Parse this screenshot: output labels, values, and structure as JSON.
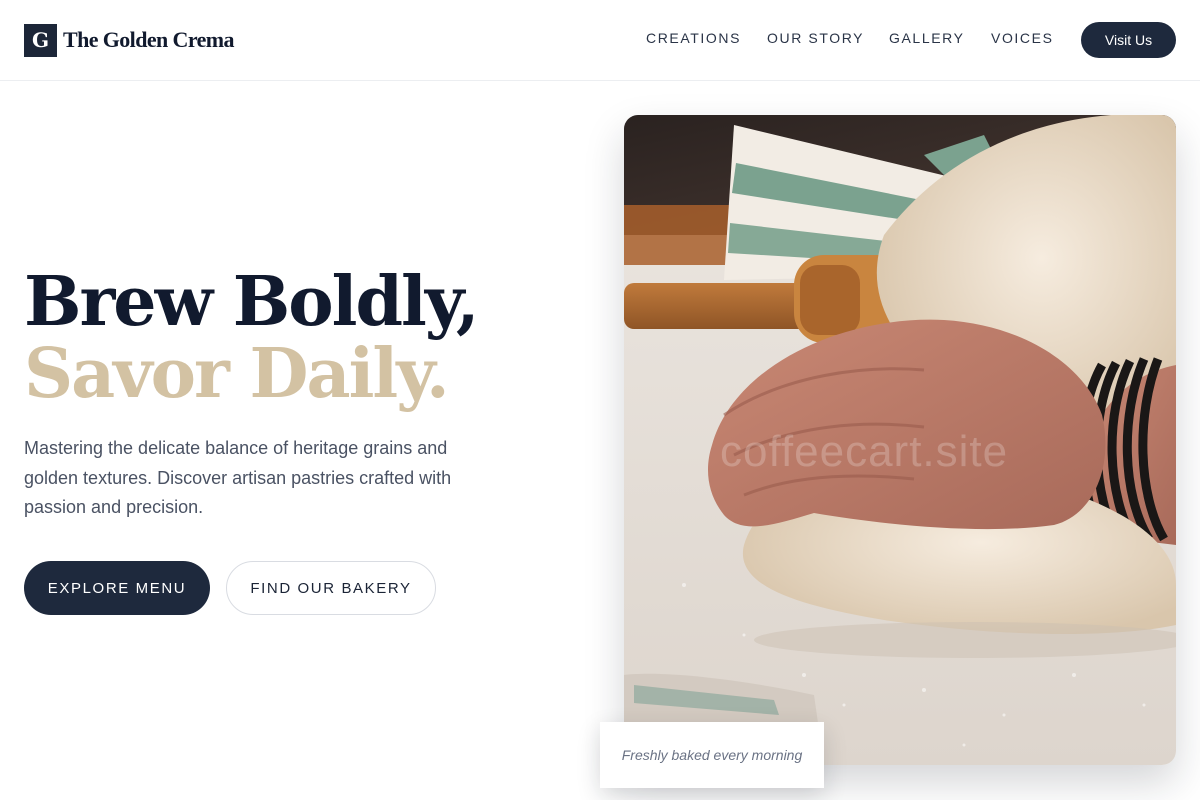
{
  "brand": {
    "logo_letter": "G",
    "name": "The Golden Crema"
  },
  "nav": {
    "items": [
      "CREATIONS",
      "OUR STORY",
      "GALLERY",
      "VOICES"
    ],
    "cta_label": "Visit Us"
  },
  "hero": {
    "headline_line1": "Brew Boldly,",
    "headline_line2": "Savor Daily.",
    "description": "Mastering the delicate balance of heritage grains and golden textures. Discover artisan pastries crafted with passion and precision.",
    "primary_button": "EXPLORE MENU",
    "secondary_button": "FIND OUR BAKERY",
    "image_watermark": "coffeecart.site",
    "image_caption": "Freshly baked every morning"
  },
  "colors": {
    "navy": "#1e293d",
    "gold_accent": "#d3c2a3",
    "text_muted": "#4a5263",
    "background": "#ffffff"
  }
}
